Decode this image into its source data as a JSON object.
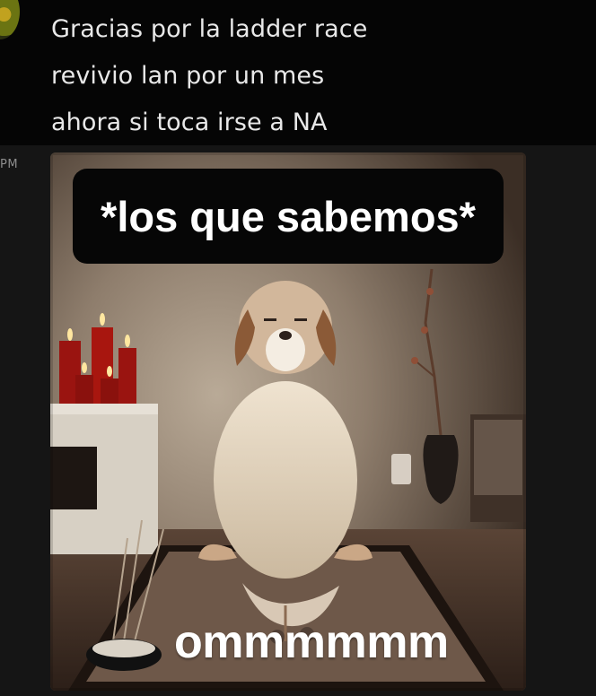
{
  "message": {
    "lines": [
      "Gracias por la ladder race",
      "revivio lan por un mes",
      "ahora si toca irse a NA"
    ],
    "timestamp_fragment": "PM"
  },
  "meme": {
    "caption_top": "*los que sabemos*",
    "caption_bottom": "ommmmmm"
  },
  "colors": {
    "background": "#151515",
    "message_block": "#050505",
    "message_text": "#e8e8e8",
    "caption_box": "#060606",
    "caption_text": "#ffffff"
  }
}
